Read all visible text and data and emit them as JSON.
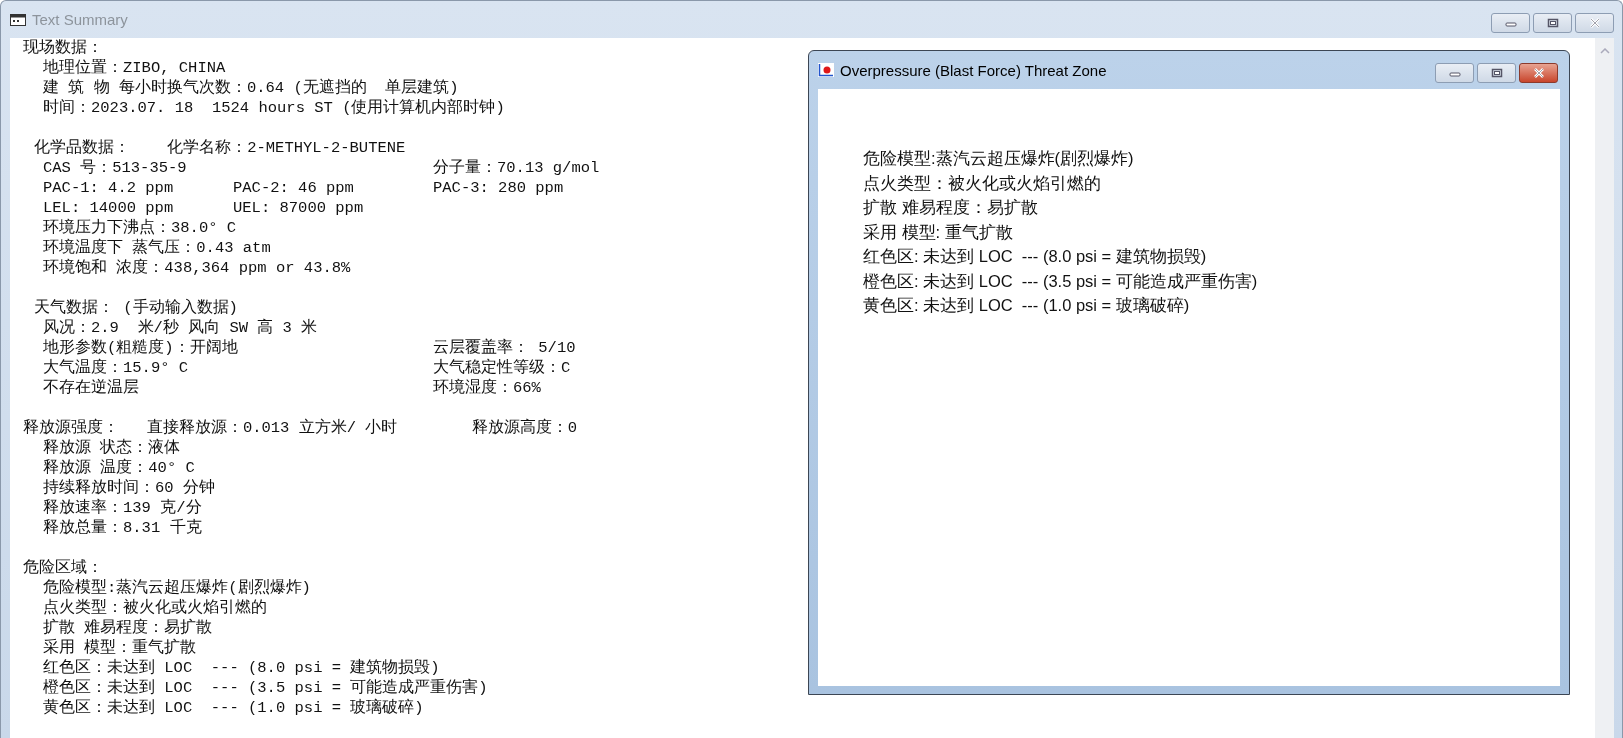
{
  "window": {
    "title": "Text Summary",
    "active": false
  },
  "summary": {
    "sections": [
      {
        "heading": "现场数据：",
        "kind": "flush",
        "lines": [
          {
            "text": "地理位置：ZIBO, CHINA"
          },
          {
            "text": "建 筑 物 每小时换气次数：0.64 (无遮挡的  单层建筑)"
          },
          {
            "text": "时间：2023.07. 18  1524 hours ST (使用计算机内部时钟)"
          }
        ]
      },
      {
        "heading": "化学品数据：    化学名称：2-METHYL-2-BUTENE",
        "kind": "indented",
        "lines": [
          {
            "text": "CAS 号：513-35-9",
            "right": "分子量：70.13 g/mol"
          },
          {
            "text": "PAC-1: 4.2 ppm",
            "middle": "PAC-2: 46 ppm",
            "right": "PAC-3: 280 ppm"
          },
          {
            "text": "LEL: 14000 ppm",
            "middle": "UEL: 87000 ppm"
          },
          {
            "text": "环境压力下沸点：38.0° C"
          },
          {
            "text": "环境温度下 蒸气压：0.43 atm"
          },
          {
            "text": "环境饱和 浓度：438,364 ppm or 43.8%"
          }
        ]
      },
      {
        "heading": "天气数据： (手动输入数据)",
        "kind": "indented",
        "lines": [
          {
            "text": "风况：2.9  米/秒 风向 SW 高 3 米"
          },
          {
            "text": "地形参数(粗糙度)：开阔地",
            "right": "云层覆盖率： 5/10"
          },
          {
            "text": "大气温度：15.9° C",
            "right": "大气稳定性等级：C"
          },
          {
            "text": "不存在逆温层",
            "right": "环境湿度：66%"
          }
        ]
      },
      {
        "heading": "释放源强度：   直接释放源：0.013 立方米/ 小时        释放源高度：0",
        "kind": "flush",
        "lines": [
          {
            "text": "释放源 状态：液体"
          },
          {
            "text": "释放源 温度：40° C"
          },
          {
            "text": "持续释放时间：60 分钟"
          },
          {
            "text": "释放速率：139 克/分"
          },
          {
            "text": "释放总量：8.31 千克"
          }
        ]
      },
      {
        "heading": "危险区域：",
        "kind": "flush",
        "lines": [
          {
            "text": "危险模型:蒸汽云超压爆炸(剧烈爆炸)"
          },
          {
            "text": "点火类型：被火化或火焰引燃的"
          },
          {
            "text": "扩散 难易程度：易扩散"
          },
          {
            "text": "采用 模型：重气扩散"
          },
          {
            "text": "红色区：未达到 LOC  --- (8.0 psi = 建筑物损毁)"
          },
          {
            "text": "橙色区：未达到 LOC  --- (3.5 psi = 可能造成严重伤害)"
          },
          {
            "text": "黄色区：未达到 LOC  --- (1.0 psi = 玻璃破碎)"
          }
        ]
      }
    ]
  },
  "threat_zone_window": {
    "title": "Overpressure (Blast Force) Threat Zone",
    "active": true,
    "lines": [
      "危险模型:蒸汽云超压爆炸(剧烈爆炸)",
      "点火类型：被火化或火焰引燃的",
      "扩散 难易程度：易扩散",
      "采用 模型: 重气扩散",
      "红色区: 未达到 LOC  --- (8.0 psi = 建筑物损毁)",
      "橙色区: 未达到 LOC  --- (3.5 psi = 可能造成严重伤害)",
      "黄色区: 未达到 LOC  --- (1.0 psi = 玻璃破碎)"
    ]
  }
}
